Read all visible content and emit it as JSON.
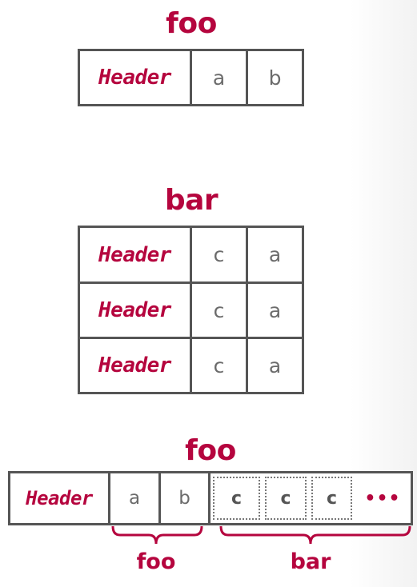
{
  "top_table": {
    "title": "foo",
    "header": "Header",
    "values": [
      "a",
      "b"
    ]
  },
  "middle_table": {
    "title": "bar",
    "rows": [
      {
        "header": "Header",
        "values": [
          "c",
          "a"
        ]
      },
      {
        "header": "Header",
        "values": [
          "c",
          "a"
        ]
      },
      {
        "header": "Header",
        "values": [
          "c",
          "a"
        ]
      }
    ]
  },
  "combined": {
    "title": "foo",
    "header": "Header",
    "values": [
      "a",
      "b"
    ],
    "repeated_values": [
      "c",
      "c",
      "c"
    ],
    "ellipsis": "•••",
    "brace_labels": [
      "foo",
      "bar"
    ]
  },
  "colors": {
    "accent": "#b5053e",
    "border": "#555555",
    "value_text": "#6b6b6b"
  }
}
